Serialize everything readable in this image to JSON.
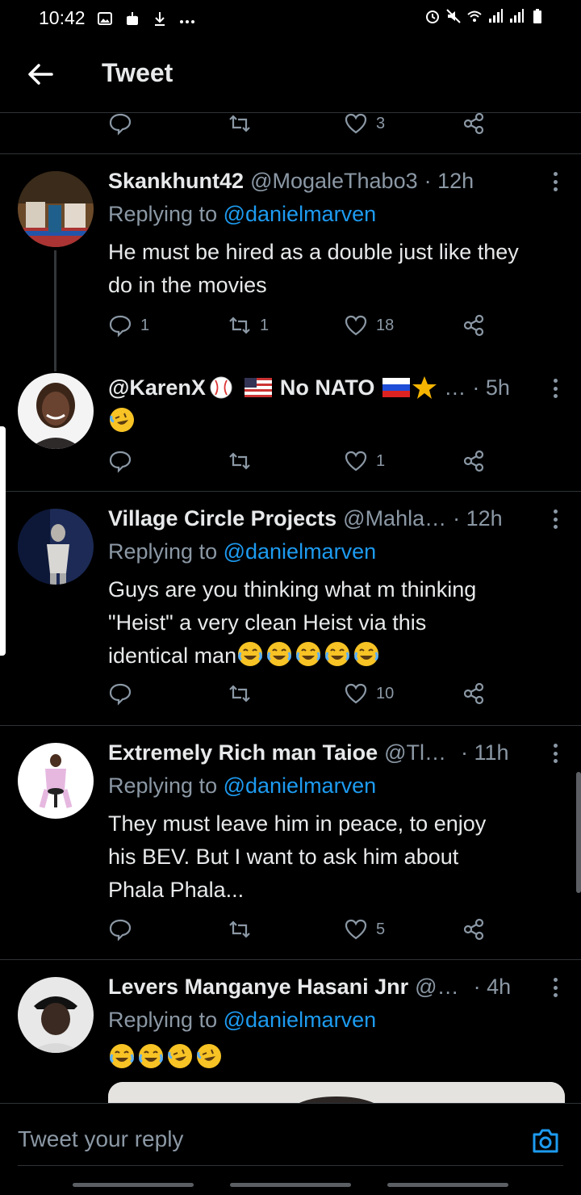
{
  "status_bar": {
    "time": "10:42",
    "left_icons": [
      "image-icon",
      "download-box-icon",
      "download-icon",
      "more-dots-icon"
    ],
    "right_icons": [
      "alarm-icon",
      "mute-icon",
      "wifi-icon",
      "signal-icon",
      "signal-icon",
      "battery-icon"
    ]
  },
  "header": {
    "title": "Tweet",
    "back_icon": "arrow-left-icon"
  },
  "top_actions": {
    "reply_count": "",
    "retweet_count": "",
    "like_count": "3"
  },
  "tweets": [
    {
      "name": "Skankhunt42",
      "handle": "@MogaleThabo3",
      "time": "· 12h",
      "replying_prefix": "Replying to ",
      "replying_to": "@danielmarven",
      "text": "He must be hired as a double just like they do in the movies",
      "replies": "1",
      "retweets": "1",
      "likes": "18"
    },
    {
      "name": "@KarenX",
      "name_suffix": "No NATO",
      "handle": "…",
      "time": "· 5h",
      "text": "",
      "emoji": [
        "rofl"
      ],
      "replies": "",
      "retweets": "",
      "likes": "1"
    },
    {
      "name": "Village Circle Projects",
      "handle": "@Mahla…",
      "time": "· 12h",
      "replying_prefix": "Replying to ",
      "replying_to": "@danielmarven",
      "text_lines": [
        "Guys are you thinking what m thinking",
        "\"Heist\" a very clean Heist via this",
        "identical man"
      ],
      "emoji": [
        "joy",
        "joy",
        "joy",
        "joy",
        "joy"
      ],
      "replies": "",
      "retweets": "",
      "likes": "10"
    },
    {
      "name": "Extremely Rich man Taioe",
      "handle": "@Tl…",
      "time": "· 11h",
      "replying_prefix": "Replying to ",
      "replying_to": "@danielmarven",
      "text_lines": [
        "They must leave him in peace, to enjoy",
        "his BEV. But I want to ask him about",
        "Phala Phala..."
      ],
      "replies": "",
      "retweets": "",
      "likes": "5"
    },
    {
      "name": "Levers Manganye Hasani Jnr",
      "handle": "@…",
      "time": "· 4h",
      "replying_prefix": "Replying to ",
      "replying_to": "@danielmarven",
      "emoji": [
        "joy",
        "joy",
        "rofl",
        "rofl"
      ]
    }
  ],
  "reply_bar": {
    "placeholder": "Tweet your reply",
    "camera_icon": "camera-icon"
  },
  "colors": {
    "background": "#000000",
    "text": "#e7e9ea",
    "secondary": "#8b98a5",
    "link": "#1d9bf0",
    "divider": "#2f3336"
  }
}
